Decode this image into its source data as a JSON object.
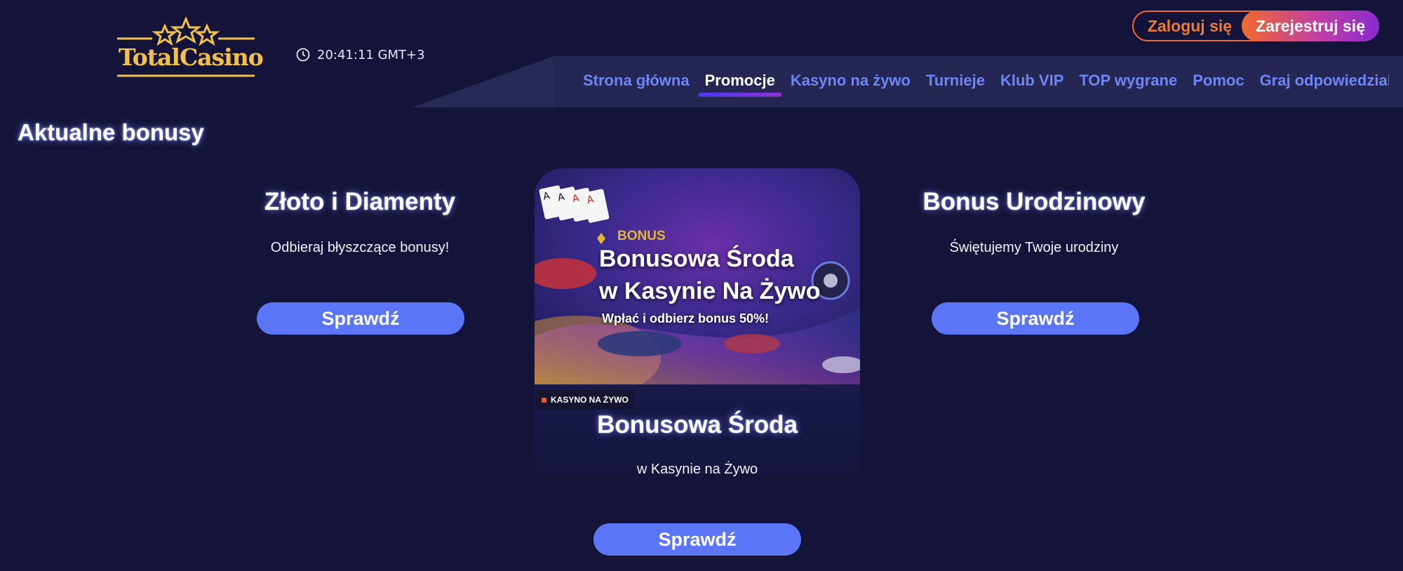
{
  "header": {
    "logo_text": "TotalCasino",
    "clock": {
      "icon": "clock-icon",
      "time": "20:41:11 GMT+3"
    },
    "auth": {
      "login_label": "Zaloguj się",
      "register_label": "Zarejestruj się"
    }
  },
  "nav": {
    "items": [
      {
        "label": "Strona główna",
        "active": false
      },
      {
        "label": "Promocje",
        "active": true
      },
      {
        "label": "Kasyno na żywo",
        "active": false
      },
      {
        "label": "Turnieje",
        "active": false
      },
      {
        "label": "Klub VIP",
        "active": false
      },
      {
        "label": "TOP wygrane",
        "active": false
      },
      {
        "label": "Pomoc",
        "active": false
      },
      {
        "label": "Graj odpowiedzialni",
        "active": false
      }
    ]
  },
  "main": {
    "title": "Aktualne bonusy",
    "cards": [
      {
        "title": "Złoto i Diamenty",
        "description": "Odbieraj błyszczące bonusy!",
        "button": "Sprawdź"
      },
      {
        "title": "Bonusowa Środa",
        "description": "w Kasynie na Żywo",
        "button": "Sprawdź",
        "badge": "KASYNO NA ŻYWO",
        "banner": {
          "tag": "BONUS",
          "line1": "Bonusowa Środa",
          "line2": "w Kasynie Na Żywo",
          "subtitle": "Wpłać i odbierz bonus 50%!"
        }
      },
      {
        "title": "Bonus Urodzinowy",
        "description": "Świętujemy Twoje urodziny",
        "button": "Sprawdź"
      }
    ]
  },
  "colors": {
    "background": "#14143a",
    "nav_link": "#6b86f5",
    "button": "#5a76f7",
    "login_accent": "#ef6a2c",
    "register_gradient_end": "#8a2bd0",
    "logo_gold": "#f2c149"
  }
}
